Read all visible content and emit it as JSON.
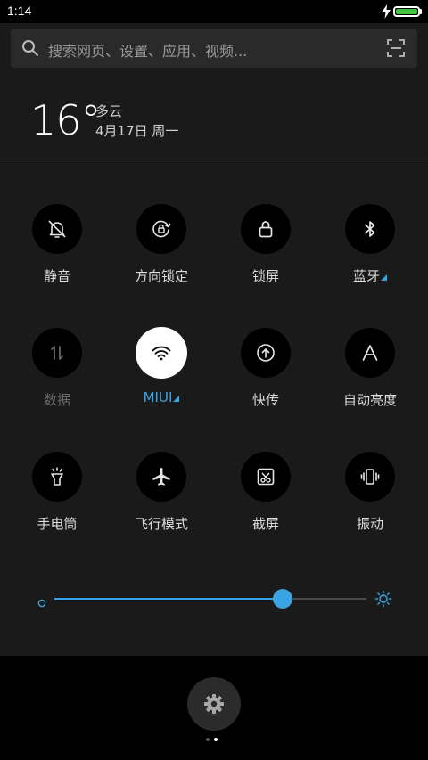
{
  "status_bar": {
    "time": "1:14",
    "battery_level": 1.0,
    "charging": true
  },
  "search": {
    "placeholder": "搜索网页、设置、应用、视频..."
  },
  "weather": {
    "temperature": "16°",
    "condition": "多云",
    "date": "4月17日 周一"
  },
  "toggles": [
    {
      "label": "静音",
      "icon": "bell-off-icon",
      "state": "off"
    },
    {
      "label": "方向锁定",
      "icon": "rotation-lock-icon",
      "state": "off"
    },
    {
      "label": "锁屏",
      "icon": "lock-icon",
      "state": "off"
    },
    {
      "label": "蓝牙",
      "icon": "bluetooth-icon",
      "state": "off",
      "has_more": true
    },
    {
      "label": "数据",
      "icon": "mobile-data-icon",
      "state": "disabled"
    },
    {
      "label": "MIUI",
      "icon": "wifi-icon",
      "state": "on",
      "has_more": true
    },
    {
      "label": "快传",
      "icon": "share-upload-icon",
      "state": "off"
    },
    {
      "label": "自动亮度",
      "icon": "auto-brightness-icon",
      "state": "off"
    },
    {
      "label": "手电筒",
      "icon": "flashlight-icon",
      "state": "off"
    },
    {
      "label": "飞行模式",
      "icon": "airplane-icon",
      "state": "off"
    },
    {
      "label": "截屏",
      "icon": "screenshot-icon",
      "state": "off"
    },
    {
      "label": "振动",
      "icon": "vibrate-icon",
      "state": "off"
    }
  ],
  "brightness": {
    "level": 0.73
  },
  "pager": {
    "pages": 2,
    "current": 2
  },
  "colors": {
    "accent": "#3aa3e3",
    "panel_bg": "#1a1a1a",
    "battery": "#3cc43a"
  }
}
